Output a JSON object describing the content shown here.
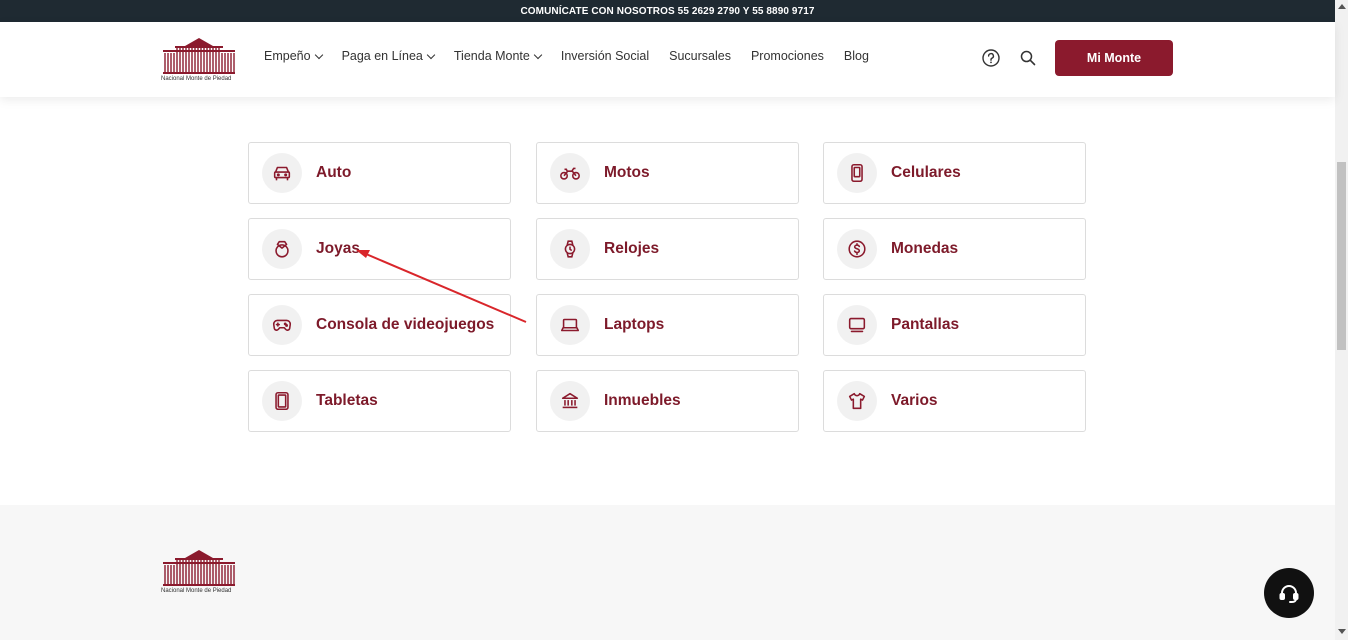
{
  "topbar": {
    "text": "COMUNÍCATE CON NOSOTROS 55 2629 2790 Y 55 8890 9717"
  },
  "header": {
    "logo_text": "Nacional Monte de Piedad",
    "nav": [
      {
        "label": "Empeño",
        "dropdown": true
      },
      {
        "label": "Paga en Línea",
        "dropdown": true
      },
      {
        "label": "Tienda Monte",
        "dropdown": true
      },
      {
        "label": "Inversión Social",
        "dropdown": false
      },
      {
        "label": "Sucursales",
        "dropdown": false
      },
      {
        "label": "Promociones",
        "dropdown": false
      },
      {
        "label": "Blog",
        "dropdown": false
      }
    ],
    "cta_label": "Mi Monte"
  },
  "categories": [
    {
      "label": "Auto",
      "icon": "car-icon"
    },
    {
      "label": "Motos",
      "icon": "motorcycle-icon"
    },
    {
      "label": "Celulares",
      "icon": "phone-icon"
    },
    {
      "label": "Joyas",
      "icon": "ring-icon"
    },
    {
      "label": "Relojes",
      "icon": "watch-icon"
    },
    {
      "label": "Monedas",
      "icon": "coin-icon"
    },
    {
      "label": "Consola de videojuegos",
      "icon": "gamepad-icon"
    },
    {
      "label": "Laptops",
      "icon": "laptop-icon"
    },
    {
      "label": "Pantallas",
      "icon": "monitor-icon"
    },
    {
      "label": "Tabletas",
      "icon": "tablet-icon"
    },
    {
      "label": "Inmuebles",
      "icon": "building-icon"
    },
    {
      "label": "Varios",
      "icon": "shirt-icon"
    }
  ],
  "footer": {
    "logo_text": "Nacional Monte de Piedad"
  },
  "colors": {
    "brand": "#8b1a2d",
    "topbar": "#1f2a32",
    "label": "#7d1a2a",
    "annotation": "#d9262b"
  }
}
